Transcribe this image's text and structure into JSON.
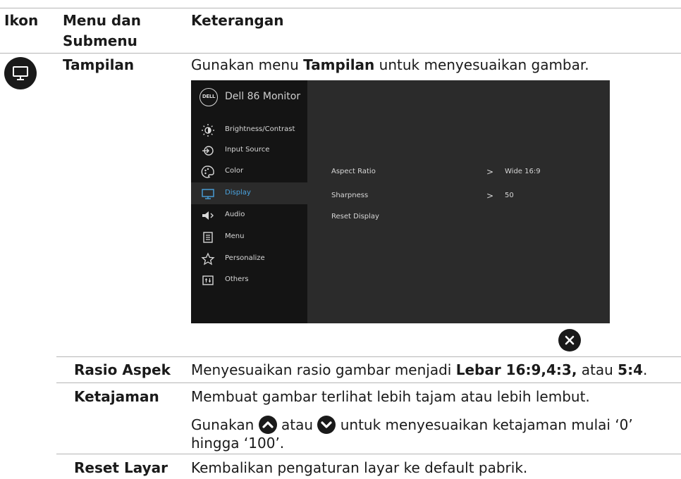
{
  "header": {
    "col_icon": "Ikon",
    "col_menu_line1": "Menu dan",
    "col_menu_line2": "Submenu",
    "col_desc": "Keterangan"
  },
  "main_row": {
    "menu_name": "Tampilan",
    "desc_prefix": "Gunakan menu ",
    "desc_bold": "Tampilan",
    "desc_suffix": " untuk menyesuaikan gambar."
  },
  "osd": {
    "logo_text": "DELL",
    "title": "Dell 86 Monitor",
    "menu_items": [
      {
        "label": "Brightness/Contrast",
        "icon": "brightness-icon"
      },
      {
        "label": "Input Source",
        "icon": "input-source-icon"
      },
      {
        "label": "Color",
        "icon": "color-icon"
      },
      {
        "label": "Display",
        "icon": "display-icon",
        "selected": true
      },
      {
        "label": "Audio",
        "icon": "audio-icon"
      },
      {
        "label": "Menu",
        "icon": "menu-icon"
      },
      {
        "label": "Personalize",
        "icon": "star-icon"
      },
      {
        "label": "Others",
        "icon": "others-icon"
      }
    ],
    "options": [
      {
        "label": "Aspect Ratio",
        "value": "Wide 16:9"
      },
      {
        "label": "Sharpness",
        "value": "50"
      },
      {
        "label": "Reset Display",
        "value": ""
      }
    ],
    "chevron": ">",
    "accent_color": "#4aa3df"
  },
  "sub_rows": {
    "aspect": {
      "name": "Rasio Aspek",
      "desc_prefix": "Menyesuaikan rasio gambar menjadi ",
      "b1": "Lebar 16:9,4:3,",
      "mid": " atau ",
      "b2": "5:4",
      "end": "."
    },
    "sharpness": {
      "name": "Ketajaman",
      "line1": "Membuat gambar terlihat lebih tajam atau lebih lembut.",
      "l2_a": "Gunakan ",
      "l2_b": " atau ",
      "l2_c": " untuk menyesuaikan ketajaman mulai ‘0’",
      "line3": "hingga ‘100’."
    },
    "reset": {
      "name": "Reset Layar",
      "desc": "Kembalikan pengaturan layar ke default pabrik."
    }
  }
}
